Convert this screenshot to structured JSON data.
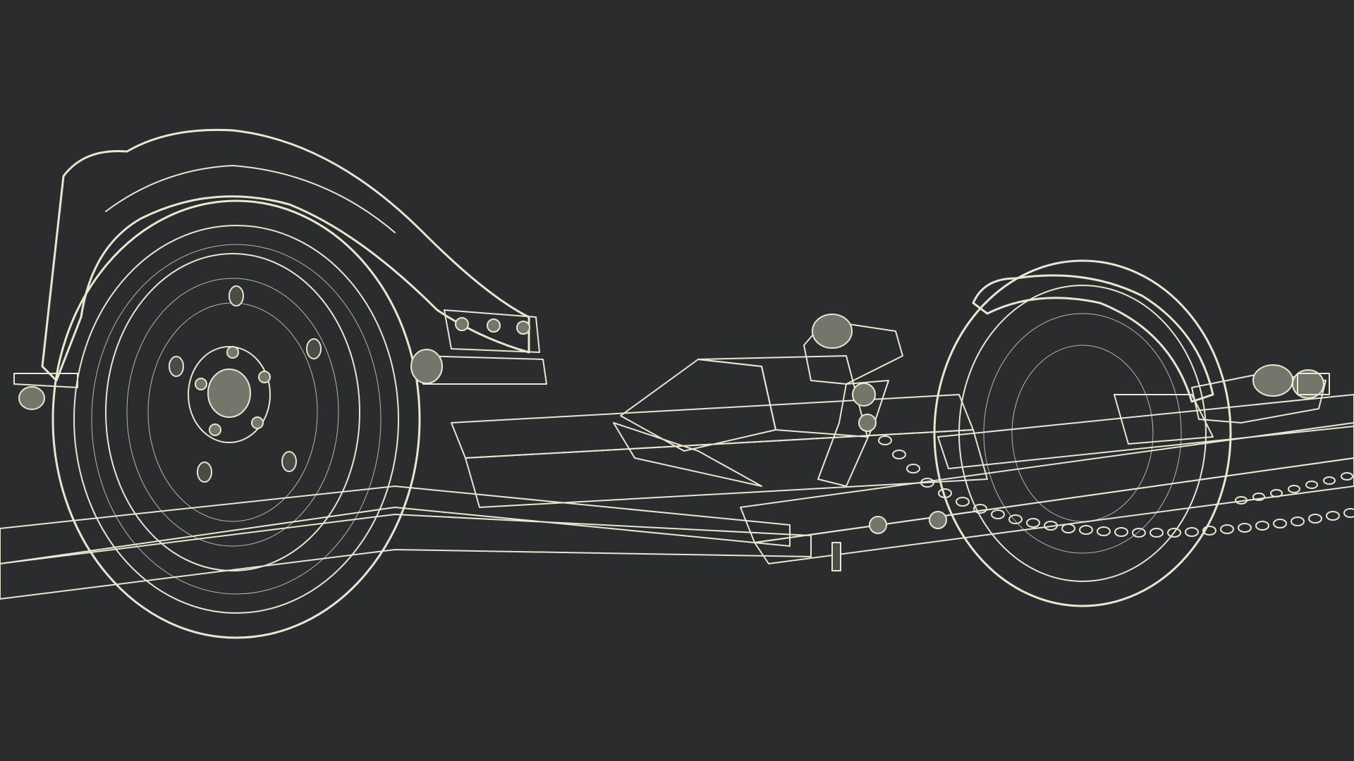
{
  "scene": {
    "subject": "tow-dolly-wireframe",
    "colors": {
      "background": "#2b2c2d",
      "wire": "#e9e6d2",
      "surface": "#5d5f55",
      "surface_light": "#73766a",
      "surface_dark": "#4b4c46"
    }
  }
}
